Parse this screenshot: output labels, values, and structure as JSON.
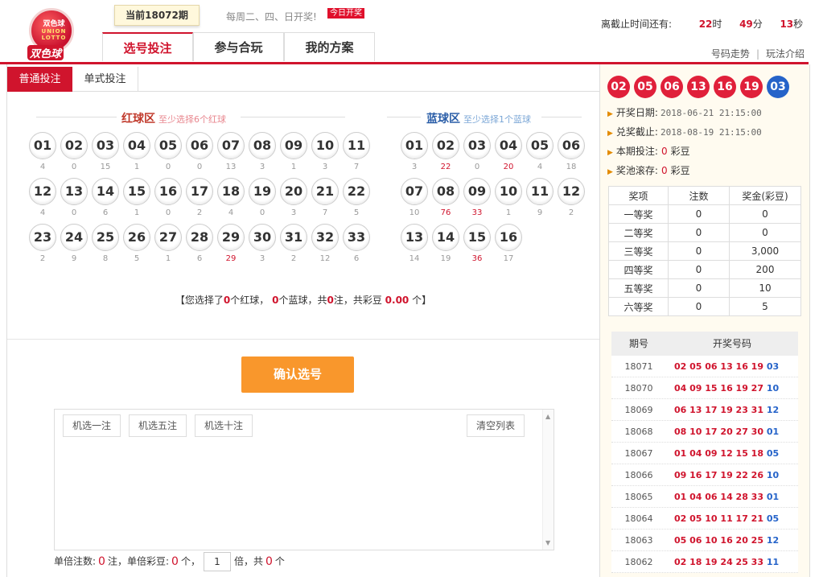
{
  "header": {
    "logo_top": "双色球",
    "logo_union": "UNION LOTTO",
    "logo_text": "双色球",
    "issue_tag": "当前18072期",
    "draw_days": "每周二、四、日开奖!",
    "today_badge": "今日开奖",
    "tabs": [
      "选号投注",
      "参与合玩",
      "我的方案"
    ],
    "countdown_label": "离截止时间还有:",
    "countdown_hours": "22",
    "unit_h": "时",
    "countdown_minutes": "49",
    "unit_m": "分",
    "countdown_seconds": "13",
    "unit_s": "秒",
    "link_trend": "号码走势",
    "link_sep": "|",
    "link_rules": "玩法介绍"
  },
  "subtabs": [
    "普通投注",
    "单式投注"
  ],
  "red_zone": {
    "title": "红球区",
    "hint": "至少选择6个红球",
    "balls": [
      "01",
      "02",
      "03",
      "04",
      "05",
      "06",
      "07",
      "08",
      "09",
      "10",
      "11",
      "12",
      "13",
      "14",
      "15",
      "16",
      "17",
      "18",
      "19",
      "20",
      "21",
      "22",
      "23",
      "24",
      "25",
      "26",
      "27",
      "28",
      "29",
      "30",
      "31",
      "32",
      "33"
    ],
    "miss": [
      "4",
      "0",
      "15",
      "1",
      "0",
      "0",
      "13",
      "3",
      "1",
      "3",
      "7",
      "4",
      "0",
      "6",
      "1",
      "0",
      "2",
      "4",
      "0",
      "3",
      "7",
      "5",
      "2",
      "9",
      "8",
      "5",
      "1",
      "6",
      "29",
      "3",
      "2",
      "12",
      "6"
    ],
    "hot": [
      false,
      false,
      false,
      false,
      false,
      false,
      false,
      false,
      false,
      false,
      false,
      false,
      false,
      false,
      false,
      false,
      false,
      false,
      false,
      false,
      false,
      false,
      false,
      false,
      false,
      false,
      false,
      false,
      true,
      false,
      false,
      false,
      false
    ]
  },
  "blue_zone": {
    "title": "蓝球区",
    "hint": "至少选择1个蓝球",
    "balls": [
      "01",
      "02",
      "03",
      "04",
      "05",
      "06",
      "07",
      "08",
      "09",
      "10",
      "11",
      "12",
      "13",
      "14",
      "15",
      "16"
    ],
    "miss": [
      "3",
      "22",
      "0",
      "20",
      "4",
      "18",
      "10",
      "76",
      "33",
      "1",
      "9",
      "2",
      "14",
      "19",
      "36",
      "17"
    ],
    "hot": [
      false,
      true,
      false,
      true,
      false,
      false,
      false,
      true,
      true,
      false,
      false,
      false,
      false,
      false,
      true,
      false
    ]
  },
  "summary": {
    "open": "【您选择了",
    "red_count": "0",
    "t1": "个红球，",
    "blue_count": "0",
    "t2": "个蓝球，共",
    "bets": "0",
    "t3": "注，共彩豆",
    "beans": "0.00",
    "t4": "个】"
  },
  "confirm_label": "确认选号",
  "list_buttons": [
    "机选一注",
    "机选五注",
    "机选十注"
  ],
  "clear_label": "清空列表",
  "footer": {
    "bets_label": "单倍注数:",
    "bets_value": "0",
    "bets_unit": "注，单倍彩豆:",
    "beans_value": "0",
    "beans_unit": "个，",
    "multiplier": "1",
    "mult_unit": "倍，共",
    "total_value": "0",
    "total_unit": "个"
  },
  "latest_draw": {
    "red": [
      "02",
      "05",
      "06",
      "13",
      "16",
      "19"
    ],
    "blue": "03",
    "draw_date_label": "开奖日期:",
    "draw_date": "2018-06-21 21:15:00",
    "claim_label": "兑奖截止:",
    "claim_date": "2018-08-19 21:15:00",
    "bet_label": "本期投注:",
    "bet_value": "0",
    "bet_unit": "彩豆",
    "pool_label": "奖池滚存:",
    "pool_value": "0",
    "pool_unit": "彩豆"
  },
  "prize_table": {
    "headers": [
      "奖项",
      "注数",
      "奖金(彩豆)"
    ],
    "rows": [
      [
        "一等奖",
        "0",
        "0"
      ],
      [
        "二等奖",
        "0",
        "0"
      ],
      [
        "三等奖",
        "0",
        "3,000"
      ],
      [
        "四等奖",
        "0",
        "200"
      ],
      [
        "五等奖",
        "0",
        "10"
      ],
      [
        "六等奖",
        "0",
        "5"
      ]
    ]
  },
  "history": {
    "headers": [
      "期号",
      "开奖号码"
    ],
    "rows": [
      {
        "issue": "18071",
        "red": "02 05 06 13 16 19",
        "blue": "03"
      },
      {
        "issue": "18070",
        "red": "04 09 15 16 19 27",
        "blue": "10"
      },
      {
        "issue": "18069",
        "red": "06 13 17 19 23 31",
        "blue": "12"
      },
      {
        "issue": "18068",
        "red": "08 10 17 20 27 30",
        "blue": "01"
      },
      {
        "issue": "18067",
        "red": "01 04 09 12 15 18",
        "blue": "05"
      },
      {
        "issue": "18066",
        "red": "09 16 17 19 22 26",
        "blue": "10"
      },
      {
        "issue": "18065",
        "red": "01 04 06 14 28 33",
        "blue": "01"
      },
      {
        "issue": "18064",
        "red": "02 05 10 11 17 21",
        "blue": "05"
      },
      {
        "issue": "18063",
        "red": "05 06 10 16 20 25",
        "blue": "12"
      },
      {
        "issue": "18062",
        "red": "02 18 19 24 25 33",
        "blue": "11"
      }
    ]
  }
}
